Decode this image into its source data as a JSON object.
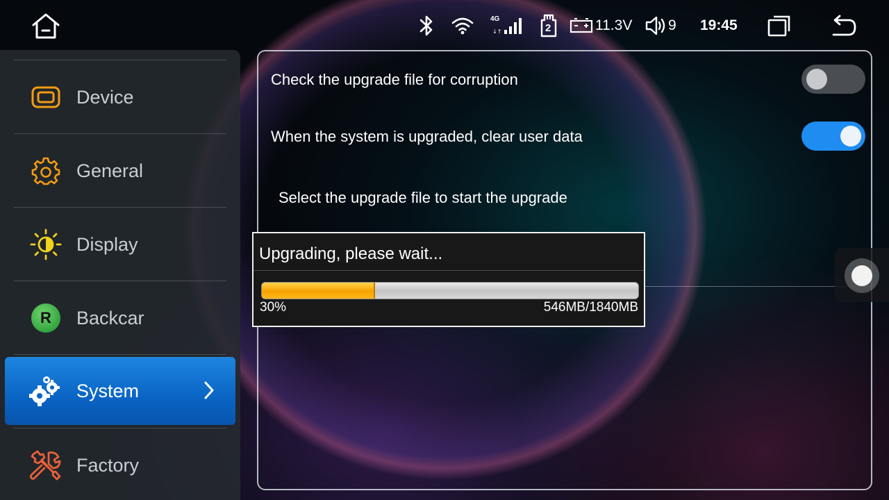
{
  "statusbar": {
    "home_icon": "home-icon",
    "bluetooth_icon": "bluetooth-icon",
    "wifi_icon": "wifi-icon",
    "signal_network": "4G",
    "sd_card_number": "2",
    "battery_voltage": "11.3V",
    "volume_level": "9",
    "clock": "19:45",
    "recent_apps_icon": "recent-apps-icon",
    "back_icon": "back-icon"
  },
  "sidebar": {
    "items": [
      {
        "label": "Device",
        "icon": "device-icon",
        "color": "#f39c12"
      },
      {
        "label": "General",
        "icon": "gear-icon",
        "color": "#f39c12"
      },
      {
        "label": "Display",
        "icon": "brightness-icon",
        "color": "#f1d21c"
      },
      {
        "label": "Backcar",
        "icon": "reverse-camera-icon",
        "color": "#3fb54a",
        "badge": "R"
      },
      {
        "label": "System",
        "icon": "system-gears-icon",
        "active": true
      },
      {
        "label": "Factory",
        "icon": "factory-tools-icon",
        "color": "#e8613a"
      }
    ]
  },
  "main": {
    "check_corruption_label": "Check the upgrade file for corruption",
    "check_corruption_enabled": false,
    "clear_user_data_label": "When the system is upgraded, clear user data",
    "clear_user_data_enabled": true,
    "select_file_label": "Select the upgrade file to start the upgrade"
  },
  "dialog": {
    "title": "Upgrading, please wait...",
    "progress_fraction": 0.3,
    "percent_label": "30%",
    "size_label": "546MB/1840MB"
  },
  "colors": {
    "accent_blue": "#1e8cf0",
    "progress_orange": "#f5a300",
    "sidebar_bg": "#262a30"
  }
}
